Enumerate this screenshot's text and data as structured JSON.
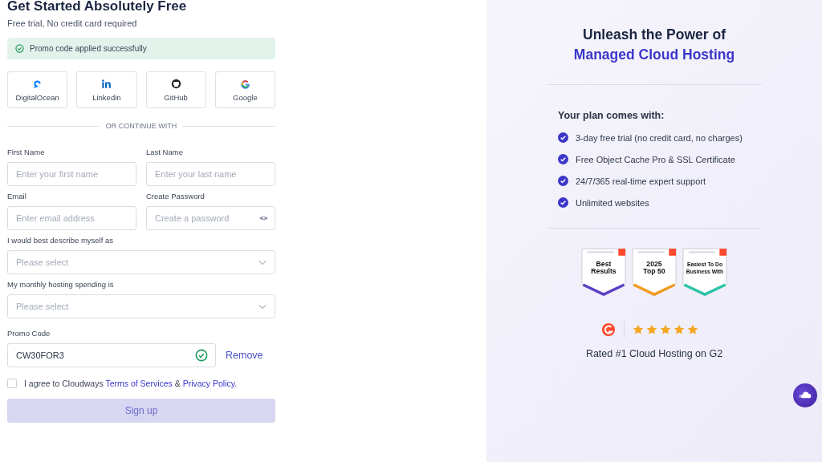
{
  "header": {
    "title": "Get Started Absolutely Free",
    "subtitle": "Free trial, No credit card required"
  },
  "alert": {
    "kind": "success",
    "text": "Promo code applied successfully"
  },
  "social": [
    {
      "kind": "digitalocean",
      "label": "DigitalOcean"
    },
    {
      "kind": "linkedin",
      "label": "Linkedin"
    },
    {
      "kind": "github",
      "label": "GitHub"
    },
    {
      "kind": "google",
      "label": "Google"
    }
  ],
  "divider_text": "OR CONTINUE WITH",
  "fields": [
    {
      "kind": "text",
      "label": "First Name",
      "placeholder": "Enter your first name"
    },
    {
      "kind": "text",
      "label": "Last Name",
      "placeholder": "Enter your last name"
    },
    {
      "kind": "text",
      "label": "Email",
      "placeholder": "Enter email address"
    },
    {
      "kind": "password",
      "label": "Create Password",
      "placeholder": "Create a password"
    },
    {
      "kind": "select",
      "label": "I would best describe myself as",
      "placeholder": "Please select"
    },
    {
      "kind": "select",
      "label": "My monthly hosting spending is",
      "placeholder": "Please select"
    }
  ],
  "promo": {
    "label": "Promo Code",
    "value": "CW30FOR3",
    "valid": true,
    "remove": "Remove"
  },
  "agreement": {
    "checked": false,
    "text": "I agree to Cloudways",
    "terms": "Terms of Services",
    "and": "&",
    "privacy": "Privacy Policy."
  },
  "signup": {
    "label": "Sign up",
    "disabled": true
  },
  "aside": {
    "title": "Unleash the Power of",
    "highlight": "Managed Cloud Hosting",
    "plan_heading": "Your plan comes with:",
    "features": [
      "3-day free trial (no credit card, no charges)",
      "Free Object Cache Pro & SSL Certificate",
      "24/7/365 real-time expert support",
      "Unlimited websites"
    ],
    "badges": [
      {
        "title": [
          "Best",
          "Results"
        ],
        "color": "#5b3fc4"
      },
      {
        "title": [
          "2025",
          "Top 50"
        ],
        "color": "#f29b1f"
      },
      {
        "title": [
          "Easiest To Do",
          "Business With"
        ],
        "color": "#2bc4a6"
      }
    ],
    "rating": {
      "stars": 5
    },
    "rated_text": "Rated #1 Cloud Hosting on G2"
  }
}
